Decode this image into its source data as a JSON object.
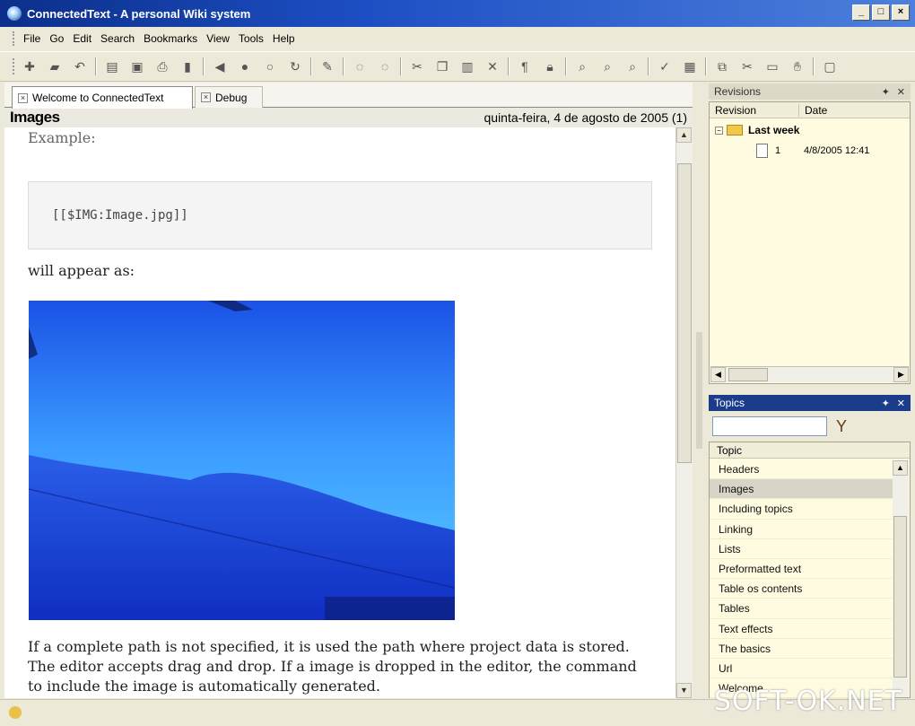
{
  "window": {
    "title": "ConnectedText - A personal Wiki system"
  },
  "menu": [
    "File",
    "Go",
    "Edit",
    "Search",
    "Bookmarks",
    "View",
    "Tools",
    "Help"
  ],
  "toolbar_icons": [
    "new-icon",
    "open-icon",
    "undo-icon",
    "paste-icon",
    "save-icon",
    "print-icon",
    "bookmark-icon",
    "back-icon",
    "forward-icon",
    "home-icon",
    "refresh-icon",
    "edit-icon",
    "circle-icon",
    "circle-icon",
    "cut-icon",
    "copy-icon",
    "paste-icon",
    "delete-icon",
    "format-icon",
    "lock-icon",
    "search-icon",
    "find-next-icon",
    "find-prev-icon",
    "spell-icon",
    "zoom-icon",
    "link-icon",
    "scissors-icon",
    "page-icon",
    "hand-icon",
    "window-icon"
  ],
  "tabs": [
    {
      "label": "Welcome to ConnectedText",
      "active": true
    },
    {
      "label": "Debug",
      "active": false
    }
  ],
  "document": {
    "title": "Images",
    "date": "quinta-feira, 4 de agosto de 2005 (1)",
    "example_label": "Example:",
    "code": "[[$IMG:Image.jpg]]",
    "appear_label": "will appear as:",
    "paragraph": "If a complete path is not specified, it is used the path where project data is stored. The editor accepts drag and drop. If a image is dropped in the editor, the command to include the image is automatically generated."
  },
  "revisions": {
    "title": "Revisions",
    "col_revision": "Revision",
    "col_date": "Date",
    "group": "Last week",
    "rows": [
      {
        "revision": "1",
        "date": "4/8/2005 12:41"
      }
    ]
  },
  "topics": {
    "title": "Topics",
    "column": "Topic",
    "search_value": "",
    "items": [
      "Headers",
      "Images",
      "Including topics",
      "Linking",
      "Lists",
      "Preformatted text",
      "Table os contents",
      "Tables",
      "Text effects",
      "The basics",
      "Url",
      "Welcome"
    ],
    "selected": "Images"
  },
  "watermark": "SOFT-OK.NET",
  "colors": {
    "titlebar": "#0b2f8a",
    "panel_bg": "#fffbe0",
    "window_bg": "#ece9d8"
  }
}
